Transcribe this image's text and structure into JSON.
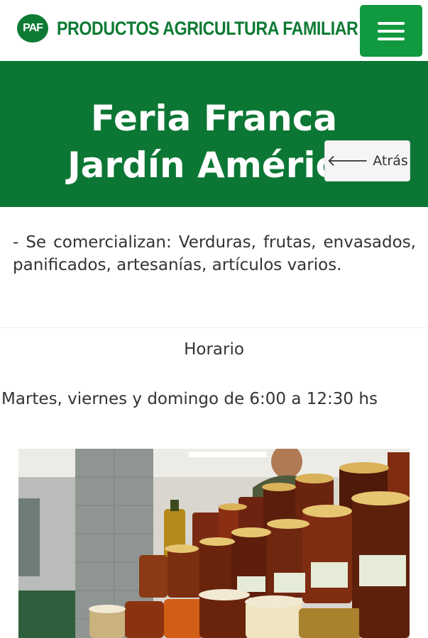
{
  "header": {
    "logo_text": "PAF",
    "brand_name": "PRODUCTOS AGRICULTURA FAMILIAR",
    "menu_icon": "hamburger-icon"
  },
  "hero": {
    "title": "Feria Franca Jardín América",
    "back_label": "Atrás",
    "back_icon": "arrow-left-icon"
  },
  "content": {
    "description": "- Se comercializan: Verduras, frutas, envasados, panificados, artesanías, artículos varios.",
    "schedule_heading": "Horario",
    "schedule_text": "Martes, viernes y domingo de 6:00 a 12:30 hs"
  },
  "colors": {
    "brand_green": "#0e7a34",
    "hero_green": "#0c7734",
    "menu_green": "#11993f"
  }
}
